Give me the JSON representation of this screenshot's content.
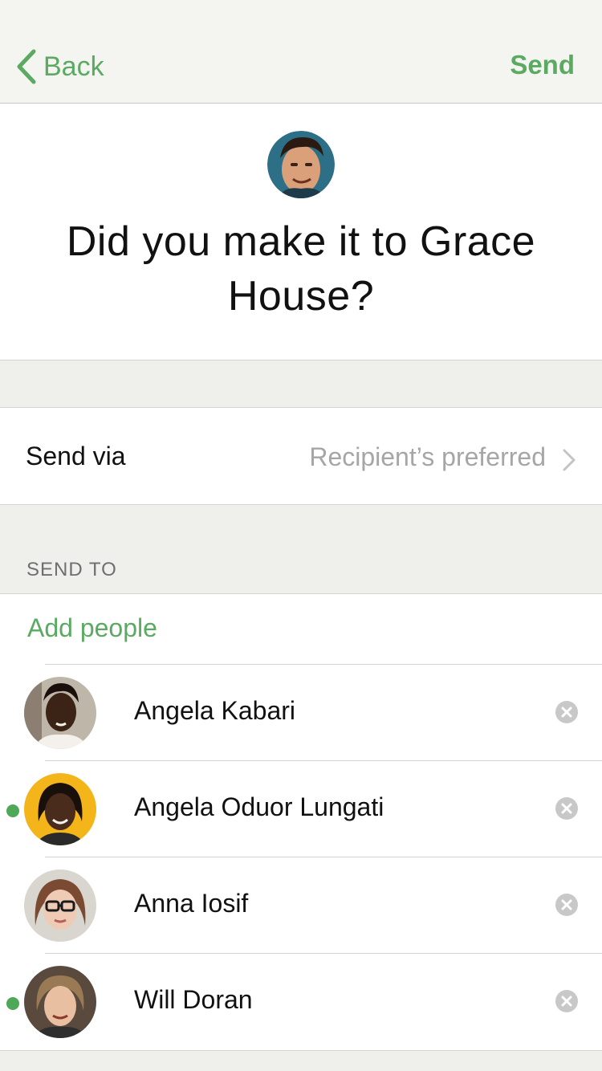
{
  "navbar": {
    "back_label": "Back",
    "send_label": "Send",
    "accent_color": "#5aab61"
  },
  "header": {
    "question": "Did you make it to Grace House?",
    "avatar_icon": "user-photo"
  },
  "send_via": {
    "label": "Send via",
    "value": "Recipient’s preferred"
  },
  "send_to": {
    "section_title": "SEND TO",
    "add_people_label": "Add people",
    "people": [
      {
        "name": "Angela Kabari",
        "online": false
      },
      {
        "name": "Angela Oduor Lungati",
        "online": true
      },
      {
        "name": "Anna Iosif",
        "online": false
      },
      {
        "name": "Will Doran",
        "online": true
      }
    ]
  }
}
